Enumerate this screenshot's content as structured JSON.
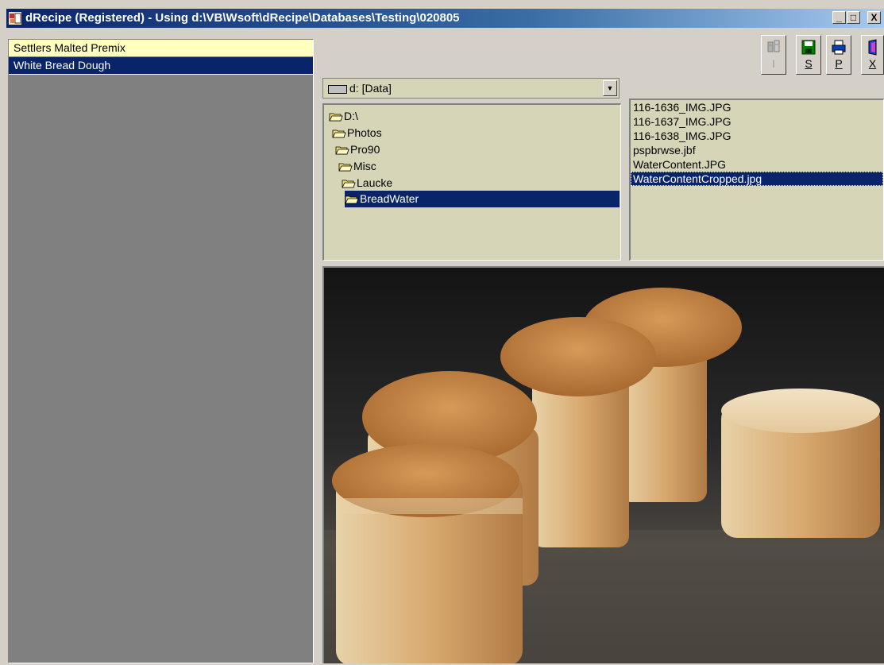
{
  "window": {
    "title": "dRecipe (Registered) - Using d:\\VB\\Wsoft\\dRecipe\\Databases\\Testing\\020805",
    "controls": [
      "_",
      "□",
      "X"
    ]
  },
  "recipes": [
    {
      "label": "Settlers Malted Premix"
    },
    {
      "label": "White Bread Dough"
    }
  ],
  "toolbar": [
    {
      "label": "I",
      "icon": "ingredients-icon",
      "enabled": false
    },
    {
      "label": "S",
      "icon": "save-disk-icon",
      "enabled": true
    },
    {
      "label": "P",
      "icon": "printer-icon",
      "enabled": true
    },
    {
      "label": "X",
      "icon": "exit-door-icon",
      "enabled": true
    }
  ],
  "drive": {
    "label": "d: [Data]"
  },
  "directories": [
    {
      "label": "D:\\"
    },
    {
      "label": "Photos"
    },
    {
      "label": "Pro90"
    },
    {
      "label": "Misc"
    },
    {
      "label": "Laucke"
    },
    {
      "label": "BreadWater"
    }
  ],
  "files": [
    {
      "label": "116-1636_IMG.JPG"
    },
    {
      "label": "116-1637_IMG.JPG"
    },
    {
      "label": "116-1638_IMG.JPG"
    },
    {
      "label": "pspbrwse.jbf"
    },
    {
      "label": "WaterContent.JPG"
    },
    {
      "label": "WaterContentCropped.jpg"
    }
  ],
  "preview": {
    "subject": "bread-loaves-photo"
  }
}
